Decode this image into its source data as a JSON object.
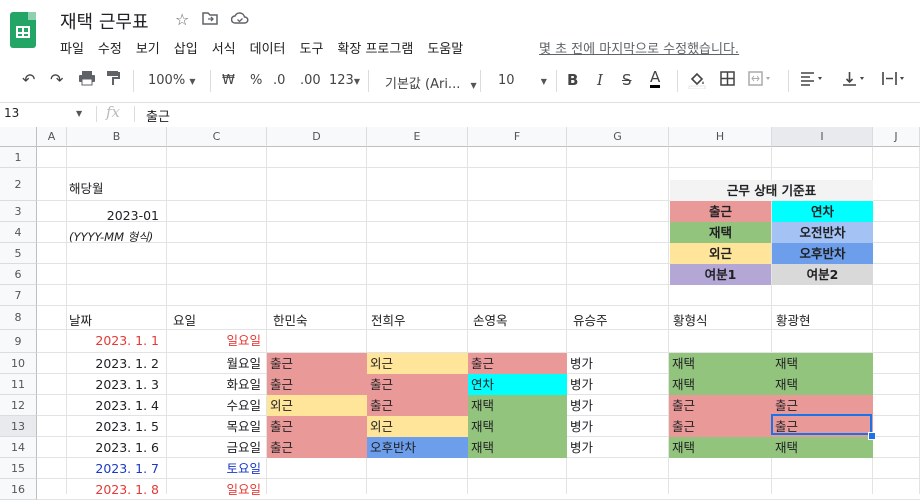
{
  "doc": {
    "title": "재택 근무표"
  },
  "menu": [
    "파일",
    "수정",
    "보기",
    "삽입",
    "서식",
    "데이터",
    "도구",
    "확장 프로그램",
    "도움말"
  ],
  "last_edit": "몇 초 전에 마지막으로 수정했습니다.",
  "toolbar": {
    "zoom": "100%",
    "currency": "₩",
    "percent": "%",
    "dec_less": ".0",
    "dec_more": ".00",
    "format": "123",
    "font": "기본값 (Ari...",
    "size": "10"
  },
  "formula": {
    "namebox": "13",
    "fx": "fx",
    "value": "출근"
  },
  "columns": [
    "A",
    "B",
    "C",
    "D",
    "E",
    "F",
    "G",
    "H",
    "I",
    "J"
  ],
  "rows": [
    "1",
    "2",
    "3",
    "4",
    "5",
    "6",
    "7",
    "8",
    "9",
    "10",
    "11",
    "12",
    "13",
    "14",
    "15",
    "16"
  ],
  "labels": {
    "month_label": "해당월",
    "month_value": "2023-01",
    "month_hint": "(YYYY-MM 형식)"
  },
  "legend": {
    "title": "근무 상태 기준표",
    "items": [
      {
        "label": "출근",
        "color": "#ea9999"
      },
      {
        "label": "연차",
        "color": "#00ffff"
      },
      {
        "label": "재택",
        "color": "#93c47d"
      },
      {
        "label": "오전반차",
        "color": "#a4c2f4"
      },
      {
        "label": "외근",
        "color": "#ffe599"
      },
      {
        "label": "오후반차",
        "color": "#6d9eeb"
      },
      {
        "label": "여분1",
        "color": "#b4a7d6"
      },
      {
        "label": "여분2",
        "color": "#d9d9d9"
      }
    ]
  },
  "table": {
    "headers": {
      "date": "날짜",
      "day": "요일",
      "p1": "한민숙",
      "p2": "전희우",
      "p3": "손영옥",
      "p4": "유승주",
      "p5": "황형식",
      "p6": "황광현"
    },
    "rows": [
      {
        "date": "2023. 1. 1",
        "day": "일요일",
        "p1": "",
        "p2": "",
        "p3": "",
        "p4": "",
        "p5": "",
        "p6": ""
      },
      {
        "date": "2023. 1. 2",
        "day": "월요일",
        "p1": "출근",
        "p2": "외근",
        "p3": "출근",
        "p4": "병가",
        "p5": "재택",
        "p6": "재택"
      },
      {
        "date": "2023. 1. 3",
        "day": "화요일",
        "p1": "출근",
        "p2": "출근",
        "p3": "연차",
        "p4": "병가",
        "p5": "재택",
        "p6": "재택"
      },
      {
        "date": "2023. 1. 4",
        "day": "수요일",
        "p1": "외근",
        "p2": "출근",
        "p3": "재택",
        "p4": "병가",
        "p5": "출근",
        "p6": "출근"
      },
      {
        "date": "2023. 1. 5",
        "day": "목요일",
        "p1": "출근",
        "p2": "외근",
        "p3": "재택",
        "p4": "병가",
        "p5": "출근",
        "p6": "출근"
      },
      {
        "date": "2023. 1. 6",
        "day": "금요일",
        "p1": "출근",
        "p2": "오후반차",
        "p3": "재택",
        "p4": "병가",
        "p5": "재택",
        "p6": "재택"
      },
      {
        "date": "2023. 1. 7",
        "day": "토요일",
        "p1": "",
        "p2": "",
        "p3": "",
        "p4": "",
        "p5": "",
        "p6": ""
      },
      {
        "date": "2023. 1. 8",
        "day": "일요일",
        "p1": "",
        "p2": "",
        "p3": "",
        "p4": "",
        "p5": "",
        "p6": ""
      }
    ]
  },
  "colors": {
    "weekday": "#202124",
    "sunday": "#e53935",
    "saturday": "#1a39c8",
    "accent": "#1a73e8"
  }
}
